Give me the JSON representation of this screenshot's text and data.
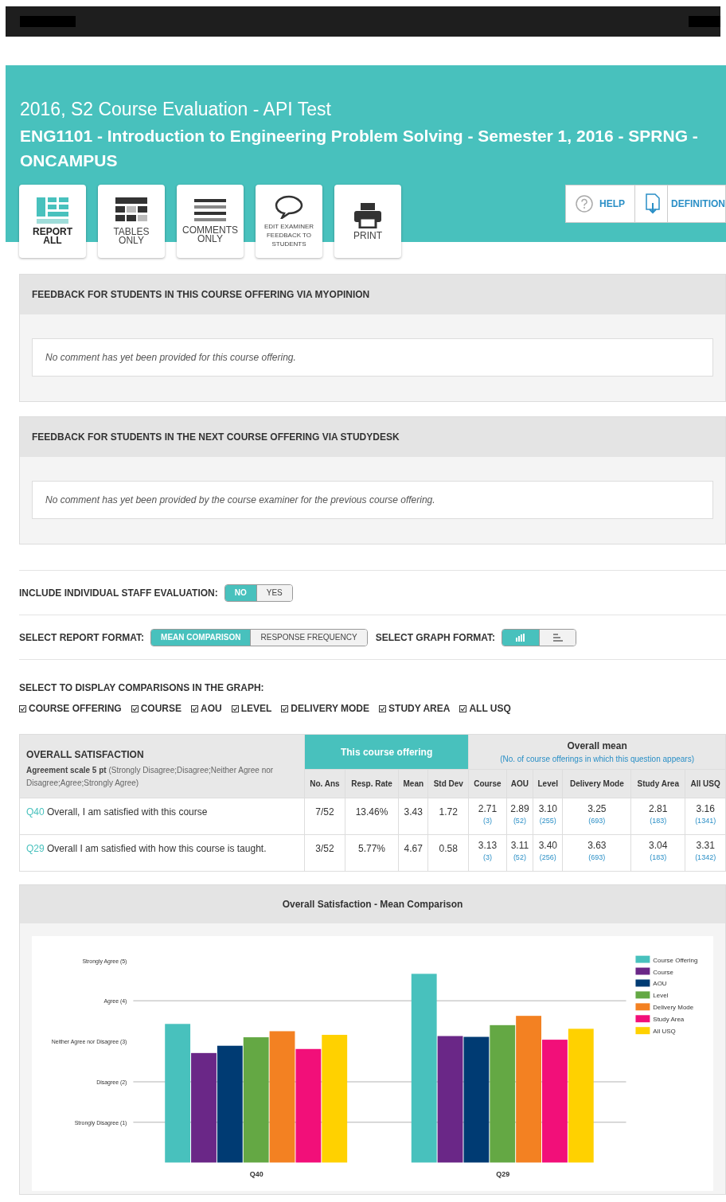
{
  "header": {
    "title": "2016, S2 Course Evaluation - API Test",
    "course": "ENG1101 - Introduction to Engineering Problem Solving - Semester 1, 2016 - SPRNG - ONCAMPUS"
  },
  "toolbar": [
    {
      "kind": "report",
      "label": "REPORT ALL",
      "selected": true
    },
    {
      "kind": "tables",
      "label": "TABLES ONLY",
      "selected": false
    },
    {
      "kind": "comments",
      "label": "COMMENTS ONLY",
      "selected": false
    },
    {
      "kind": "feedback",
      "label": "EDIT EXAMINER FEEDBACK TO STUDENTS",
      "selected": false
    },
    {
      "kind": "print",
      "label": "PRINT",
      "selected": false
    }
  ],
  "help_buttons": [
    {
      "kind": "help",
      "label": "HELP"
    },
    {
      "kind": "pdf",
      "label": "DEFINITION"
    }
  ],
  "feedback_panels": [
    {
      "title": "FEEDBACK FOR STUDENTS IN THIS COURSE OFFERING VIA MYOPINION",
      "comment": "No comment has yet been provided for this course offering."
    },
    {
      "title": "FEEDBACK FOR STUDENTS IN THE NEXT COURSE OFFERING VIA STUDYDESK",
      "comment": "No comment has yet been provided by the course examiner for the previous course offering."
    }
  ],
  "staff_evaluation": {
    "label": "INCLUDE INDIVIDUAL STAFF EVALUATION:",
    "options": [
      {
        "label": "NO",
        "selected": true
      },
      {
        "label": "YES",
        "selected": false
      }
    ]
  },
  "report_format": {
    "label": "SELECT REPORT FORMAT:",
    "options": [
      {
        "label": "MEAN COMPARISON",
        "selected": true
      },
      {
        "label": "RESPONSE FREQUENCY",
        "selected": false
      }
    ]
  },
  "graph_format": {
    "label": "SELECT GRAPH FORMAT:",
    "options": [
      {
        "kind": "vertical",
        "selected": true
      },
      {
        "kind": "horizontal",
        "selected": false
      }
    ]
  },
  "comparisons": {
    "label": "SELECT TO DISPLAY COMPARISONS IN THE GRAPH:",
    "items": [
      {
        "label": "COURSE OFFERING",
        "checked": true
      },
      {
        "label": "COURSE",
        "checked": true
      },
      {
        "label": "AOU",
        "checked": true
      },
      {
        "label": "LEVEL",
        "checked": true
      },
      {
        "label": "DELIVERY MODE",
        "checked": true
      },
      {
        "label": "STUDY AREA",
        "checked": true
      },
      {
        "label": "ALL USQ",
        "checked": true
      }
    ]
  },
  "table": {
    "title": "OVERALL SATISFACTION",
    "scale_bold": "Agreement scale 5 pt",
    "scale_rest": "(Strongly Disagree;Disagree;Neither Agree nor Disagree;Agree;Strongly Agree)",
    "group_1": "This course offering",
    "group_2": "Overall mean",
    "group_2_note": "(No. of course offerings in which this question appears)",
    "columns": [
      "No. Ans",
      "Resp. Rate",
      "Mean",
      "Std Dev",
      "Course",
      "AOU",
      "Level",
      "Delivery Mode",
      "Study Area",
      "All USQ"
    ],
    "rows": [
      {
        "code": "Q40",
        "question": "Overall, I am satisfied with this course",
        "cells": [
          "7/52",
          "13.46%",
          "3.43",
          "1.72"
        ],
        "means": [
          {
            "value": "2.71",
            "count": "(3)"
          },
          {
            "value": "2.89",
            "count": "(52)"
          },
          {
            "value": "3.10",
            "count": "(255)"
          },
          {
            "value": "3.25",
            "count": "(693)"
          },
          {
            "value": "2.81",
            "count": "(183)"
          },
          {
            "value": "3.16",
            "count": "(1341)"
          }
        ]
      },
      {
        "code": "Q29",
        "question": "Overall I am satisfied with how this course is taught.",
        "cells": [
          "3/52",
          "5.77%",
          "4.67",
          "0.58"
        ],
        "means": [
          {
            "value": "3.13",
            "count": "(3)"
          },
          {
            "value": "3.11",
            "count": "(52)"
          },
          {
            "value": "3.40",
            "count": "(256)"
          },
          {
            "value": "3.63",
            "count": "(693)"
          },
          {
            "value": "3.04",
            "count": "(183)"
          },
          {
            "value": "3.31",
            "count": "(1342)"
          }
        ]
      }
    ]
  },
  "chart_panel": {
    "title": "Overall Satisfaction - Mean Comparison",
    "chart_data": {
      "type": "bar",
      "categories": [
        "Q40",
        "Q29"
      ],
      "ylim": [
        0,
        5
      ],
      "grid": true,
      "legend": true,
      "yticks": [
        {
          "value": 1,
          "label": "Strongly Disagree (1)"
        },
        {
          "value": 2,
          "label": "Disagree (2)"
        },
        {
          "value": 3,
          "label": "Neither Agree nor Disagree (3)"
        },
        {
          "value": 4,
          "label": "Agree (4)"
        },
        {
          "value": 5,
          "label": "Strongly Agree (5)"
        }
      ],
      "series": [
        {
          "name": "Course Offering",
          "color": "#48c1bd",
          "values": [
            3.43,
            4.67
          ]
        },
        {
          "name": "Course",
          "color": "#6a2787",
          "values": [
            2.71,
            3.13
          ]
        },
        {
          "name": "AOU",
          "color": "#003b73",
          "values": [
            2.89,
            3.11
          ]
        },
        {
          "name": "Level",
          "color": "#64a844",
          "values": [
            3.1,
            3.4
          ]
        },
        {
          "name": "Delivery Mode",
          "color": "#f38122",
          "values": [
            3.25,
            3.63
          ]
        },
        {
          "name": "Study Area",
          "color": "#f20f79",
          "values": [
            2.81,
            3.04
          ]
        },
        {
          "name": "All USQ",
          "color": "#ffd100",
          "values": [
            3.16,
            3.31
          ]
        }
      ]
    }
  }
}
